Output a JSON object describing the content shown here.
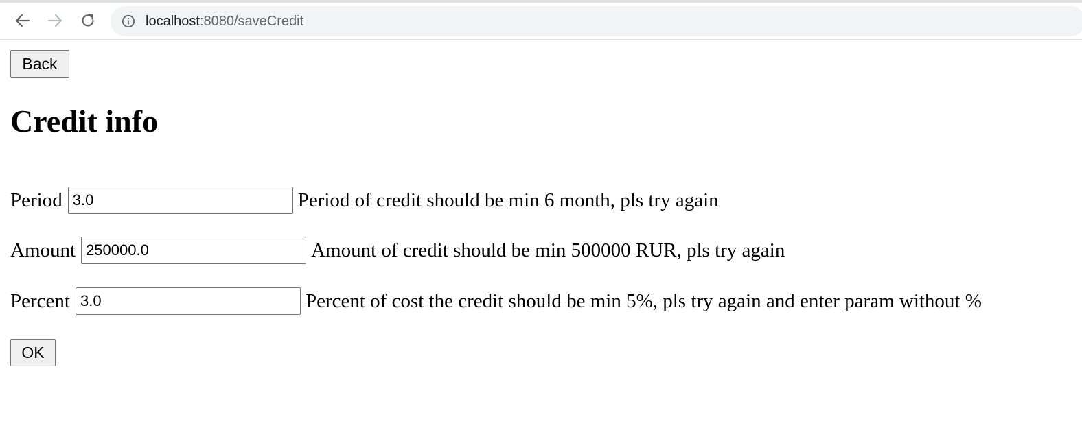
{
  "browser": {
    "url_host": "localhost",
    "url_rest": ":8080/saveCredit"
  },
  "page": {
    "back_label": "Back",
    "title": "Credit info",
    "fields": [
      {
        "label": "Period",
        "value": "3.0",
        "error": "Period of credit should be min 6 month, pls try again"
      },
      {
        "label": "Amount",
        "value": "250000.0",
        "error": "Amount of credit should be min 500000 RUR, pls try again"
      },
      {
        "label": "Percent",
        "value": "3.0",
        "error": "Percent of cost the credit should be min 5%, pls try again and enter param without %"
      }
    ],
    "ok_label": "OK"
  }
}
